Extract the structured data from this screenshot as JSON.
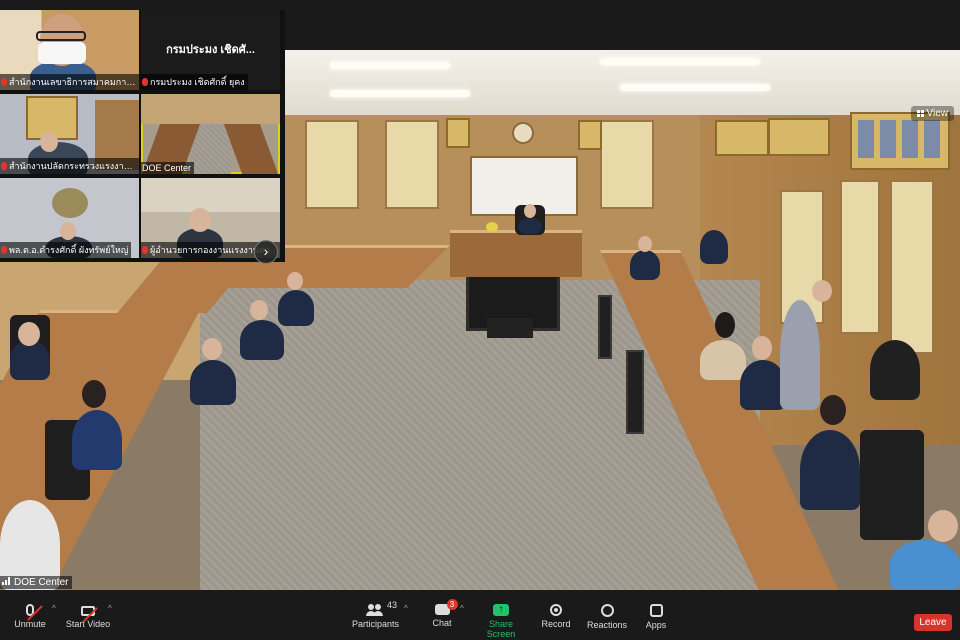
{
  "main_video": {
    "label": "DOE Center",
    "view_label": "View"
  },
  "thumbnails": [
    {
      "label": "สำนักงานเลขาธิการสมาคมการค้าและอุตสาหกรรมไทย",
      "video": "person-glasses-mask"
    },
    {
      "label": "กรมประมง  เชิดศักดิ์ ยุคง",
      "display_name": "กรมประมง  เชิดศั...",
      "video": "off"
    },
    {
      "label": "สำนักงานปลัดกระทรวงแรงงาน (พลศรี ญาณมณี)",
      "video": "person-uniform"
    },
    {
      "label": "DOE Center",
      "video": "conference-room",
      "active": true
    },
    {
      "label": "พล.ต.อ.ดำรงศักดิ์ ผังทรัพย์ใหญ่",
      "video": "person-emblem"
    },
    {
      "label": "ผู้อำนวยการกองงานแรงงานต่างด้าว",
      "video": "person-office"
    }
  ],
  "next_page_icon": "chevron-right-icon",
  "toolbar": {
    "unmute_label": "Unmute",
    "start_video_label": "Start Video",
    "participants_label": "Participants",
    "participants_count": "43",
    "chat_label": "Chat",
    "chat_badge": "3",
    "share_label": "Share Screen",
    "record_label": "Record",
    "reactions_label": "Reactions",
    "apps_label": "Apps",
    "leave_label": "Leave"
  },
  "colors": {
    "toolbar_bg": "#1a1a1a",
    "share_green": "#23c16b",
    "leave_red": "#d9342b",
    "active_speaker": "#e2d10b"
  }
}
